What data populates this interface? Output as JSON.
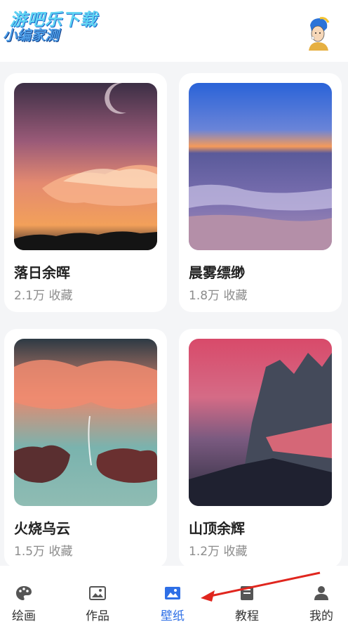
{
  "header": {
    "logo_main": "游吧乐下载",
    "logo_sub": "小编家测"
  },
  "cards": [
    {
      "title": "落日余晖",
      "meta": "2.1万 收藏"
    },
    {
      "title": "晨雾缥缈",
      "meta": "1.8万 收藏"
    },
    {
      "title": "火烧乌云",
      "meta": "1.5万 收藏"
    },
    {
      "title": "山顶余辉",
      "meta": "1.2万 收藏"
    }
  ],
  "tabs": [
    {
      "label": "绘画",
      "icon": "palette-icon"
    },
    {
      "label": "作品",
      "icon": "gallery-icon"
    },
    {
      "label": "壁纸",
      "icon": "image-icon"
    },
    {
      "label": "教程",
      "icon": "book-icon"
    },
    {
      "label": "我的",
      "icon": "person-icon"
    }
  ],
  "active_tab": "壁纸",
  "colors": {
    "accent": "#2e6fe6",
    "tab_inactive": "#333333",
    "annotation_arrow": "#e0261e"
  }
}
